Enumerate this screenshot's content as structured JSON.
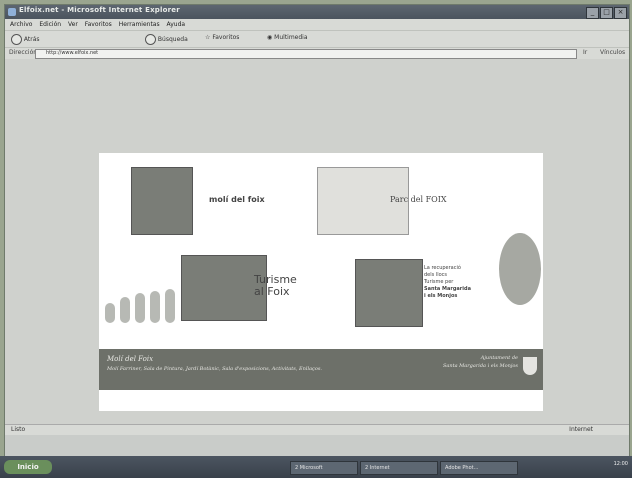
{
  "window": {
    "title": "Elfoix.net - Microsoft Internet Explorer",
    "menu": [
      "Archivo",
      "Edición",
      "Ver",
      "Favoritos",
      "Herramientas",
      "Ayuda"
    ],
    "toolbar": [
      "Atrás",
      "Búsqueda",
      "Favoritos",
      "Multimedia"
    ],
    "address_label": "Dirección",
    "address_url": "http://www.elfoix.net",
    "go_label": "Ir",
    "links_label": "Vínculos"
  },
  "page": {
    "top_center_label": "molí del foix",
    "park_label": "Parc del FOIX",
    "turisme_label_1": "Turisme",
    "turisme_label_2": "al Foix",
    "recuperacio_1": "La recuperació",
    "recuperacio_2": "dels llocs",
    "recuperacio_3": "Turisme per",
    "recuperacio_4": "Santa Margarida",
    "recuperacio_5": "i els Monjos"
  },
  "footer": {
    "title": "Molí del Foix",
    "subtitle": "Molí Farriner, Sala de Pintura, Jardí Botànic, Sala d'exposicions, Activitats, Enllaços.",
    "right_1": "Ajuntament de",
    "right_2": "Santa Margarida i els Monjos"
  },
  "status": {
    "left": "Listo",
    "right": "Internet"
  },
  "taskbar": {
    "start": "Inicio",
    "tasks": [
      "2 Microsoft",
      "2 Internet",
      "Adobe Phot..."
    ],
    "clock": "12:00"
  }
}
